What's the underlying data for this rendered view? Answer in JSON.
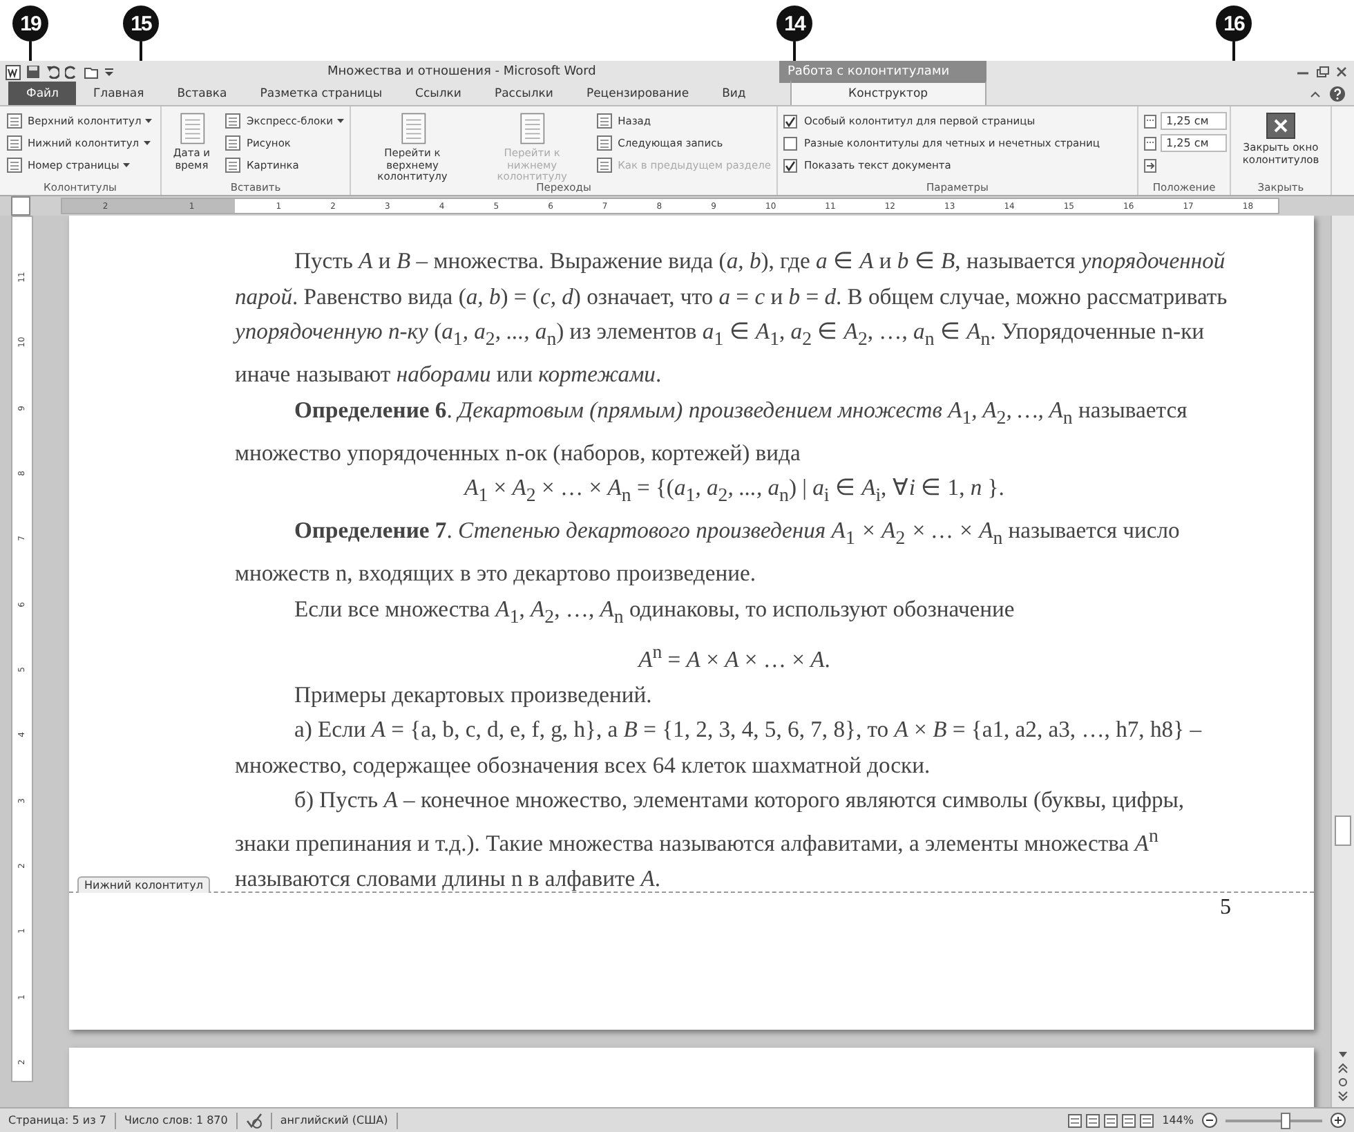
{
  "callouts": [
    {
      "number": "19"
    },
    {
      "number": "15"
    },
    {
      "number": "14"
    },
    {
      "number": "16"
    }
  ],
  "title_bar": {
    "title": "Множества и отношения  -  Microsoft Word",
    "context_group": "Работа с колонтитулами"
  },
  "tabs": [
    {
      "label": "Файл",
      "kind": "file",
      "selected": false
    },
    {
      "label": "Главная",
      "kind": "tab",
      "selected": false
    },
    {
      "label": "Вставка",
      "kind": "tab",
      "selected": false
    },
    {
      "label": "Разметка страницы",
      "kind": "tab",
      "selected": false
    },
    {
      "label": "Ссылки",
      "kind": "tab",
      "selected": false
    },
    {
      "label": "Рассылки",
      "kind": "tab",
      "selected": false
    },
    {
      "label": "Рецензирование",
      "kind": "tab",
      "selected": false
    },
    {
      "label": "Вид",
      "kind": "tab",
      "selected": false
    },
    {
      "label": "Конструктор",
      "kind": "context",
      "selected": true
    }
  ],
  "ribbon": {
    "groups": [
      {
        "label": "Колонтитулы",
        "items": [
          {
            "kind": "small",
            "label": "Верхний колонтитул",
            "dropdown": true,
            "disabled": false
          },
          {
            "kind": "small",
            "label": "Нижний колонтитул",
            "dropdown": true,
            "disabled": false
          },
          {
            "kind": "small",
            "label": "Номер страницы",
            "dropdown": true,
            "disabled": false
          }
        ]
      },
      {
        "label": "Вставить",
        "items": [
          {
            "kind": "large",
            "label": "Дата и время",
            "disabled": false
          },
          {
            "kind": "small",
            "label": "Экспресс-блоки",
            "dropdown": true,
            "disabled": false
          },
          {
            "kind": "small",
            "label": "Рисунок",
            "dropdown": false,
            "disabled": false
          },
          {
            "kind": "small",
            "label": "Картинка",
            "dropdown": false,
            "disabled": false
          }
        ]
      },
      {
        "label": "Переходы",
        "items": [
          {
            "kind": "large",
            "label": "Перейти к верхнему колонтитулу",
            "disabled": false
          },
          {
            "kind": "large",
            "label": "Перейти к нижнему колонтитулу",
            "disabled": true
          },
          {
            "kind": "small",
            "label": "Назад",
            "dropdown": false,
            "disabled": false
          },
          {
            "kind": "small",
            "label": "Следующая запись",
            "dropdown": false,
            "disabled": false
          },
          {
            "kind": "small",
            "label": "Как в предыдущем разделе",
            "dropdown": false,
            "disabled": true
          }
        ]
      },
      {
        "label": "Параметры",
        "items": [
          {
            "kind": "checkbox",
            "label": "Особый колонтитул для первой страницы",
            "checked": true
          },
          {
            "kind": "checkbox",
            "label": "Разные колонтитулы для четных и нечетных страниц",
            "checked": false
          },
          {
            "kind": "checkbox",
            "label": "Показать текст документа",
            "checked": true
          }
        ]
      },
      {
        "label": "Положение",
        "items": [
          {
            "kind": "spinner",
            "value": "1,25 см"
          },
          {
            "kind": "spinner",
            "value": "1,25 см"
          },
          {
            "kind": "icon"
          }
        ]
      },
      {
        "label": "Закрыть",
        "items": [
          {
            "kind": "close",
            "label": "Закрыть окно колонтитулов",
            "disabled": false
          }
        ]
      }
    ]
  },
  "ruler": {
    "left_numbers": [
      "2",
      "1"
    ],
    "right_numbers": [
      "1",
      "2",
      "3",
      "4",
      "5",
      "6",
      "7",
      "8",
      "9",
      "10",
      "11",
      "12",
      "13",
      "14",
      "15",
      "16",
      "17",
      "18"
    ],
    "vertical_numbers": [
      "11",
      "10",
      "9",
      "8",
      "7",
      "6",
      "5",
      "4",
      "3",
      "2",
      "1",
      "1",
      "2"
    ]
  },
  "document": {
    "paragraphs": [
      {
        "kind": "text",
        "text": "Пусть *A* и *B* – множества. Выражение вида (*a, b*), где *a* ∈ *A* и *b* ∈ *B*, называется *упорядоченной парой*. Равенство вида (*a, b*) = (*c, d*) означает, что *a* = *c* и *b* = *d*. В общем случае, можно рассматривать *упорядоченную n-ку* (*a*$_{1}$*, a*$_{2}$*, ..., a*$_{n}$) из элементов *a*$_{1}$ ∈ *A*$_{1}$, *a*$_{2}$ ∈ *A*$_{2}$, …, *a*$_{n}$ ∈ *A*$_{n}$. Упорядоченные n-ки иначе называют *наборами* или *кортежами*."
      },
      {
        "kind": "text",
        "text": "**Определение 6**. *Декартовым (прямым) произведением множеств A*$_{1}$*, A*$_{2}$*, …, A*$_{n}$ называется  множество упорядоченных n-ок (наборов, кортежей) вида"
      },
      {
        "kind": "formula",
        "text": "*A*$_{1}$ × *A*$_{2}$ × … × *A*$_{n}$ = {(*a*$_{1}$*, a*$_{2}$*, ..., a*$_{n}$) | *a*$_{i}$ ∈ *A*$_{i}$,  ∀*i* ∈ 1, *n* }."
      },
      {
        "kind": "text",
        "text": "**Определение 7**. *Степенью декартового произведения A*$_{1}$ *× A*$_{2}$ *× … × A*$_{n}$ называется число множеств n, входящих в это декартово произведение."
      },
      {
        "kind": "text",
        "text": "Если все множества *A*$_{1}$, *A*$_{2}$, …, *A*$_{n}$ одинаковы, то используют обозначение"
      },
      {
        "kind": "formula",
        "text": "*A*$^{n}$ = *A* × *A* × … × *A*."
      },
      {
        "kind": "text",
        "text": "Примеры декартовых произведений."
      },
      {
        "kind": "text",
        "text": "а) Если *A* = {a, b, c, d, e, f, g, h}, а *B* = {1, 2, 3, 4, 5, 6, 7, 8}, то *A* × *B* = {a1, a2, a3, …, h7, h8} – множество, содержащее обозначения всех 64 клеток шахматной доски."
      },
      {
        "kind": "text",
        "text": "б) Пусть *A* – конечное множество, элементами которого являются символы (буквы, цифры, знаки препинания и т.д.). Такие множества называются алфавитами, а элементы множества *A*$^{n}$ называются словами длины n в алфавите *A*."
      }
    ],
    "footer_label": "Нижний колонтитул",
    "page_number": "5"
  },
  "status_bar": {
    "page": "Страница: 5 из 7",
    "words": "Число слов: 1 870",
    "language": "английский (США)",
    "zoom": "144%",
    "level": 0.62
  }
}
